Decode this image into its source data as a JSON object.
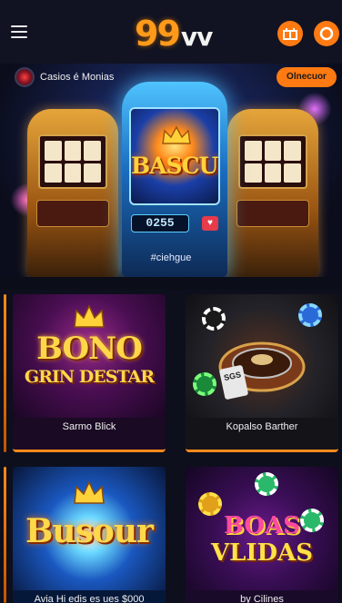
{
  "header": {
    "logo_number": "99",
    "logo_text": "vv",
    "accent_color": "#ff7a12"
  },
  "hero": {
    "site_label": "Casios é Monias",
    "cta_label": "Olnecuor",
    "machine_title": "BASCUL",
    "machine_digits": "0255",
    "tagline": "#ciehgue"
  },
  "cards": [
    {
      "title_line1": "BONO",
      "title_line2": "GRIN DESTAR",
      "caption": "Sarmo Blick"
    },
    {
      "art_label": "SGS",
      "caption": "Kopalso Barther"
    },
    {
      "title_line1": "Busour",
      "caption": "Avia   Hi edis es ues $000"
    },
    {
      "title_line1": "BOAS",
      "title_line2": "VLIDAS",
      "caption": "by Cilines"
    }
  ],
  "icons": {
    "menu": "hamburger-menu-icon",
    "gift": "gift-icon",
    "ring": "ring-icon"
  }
}
